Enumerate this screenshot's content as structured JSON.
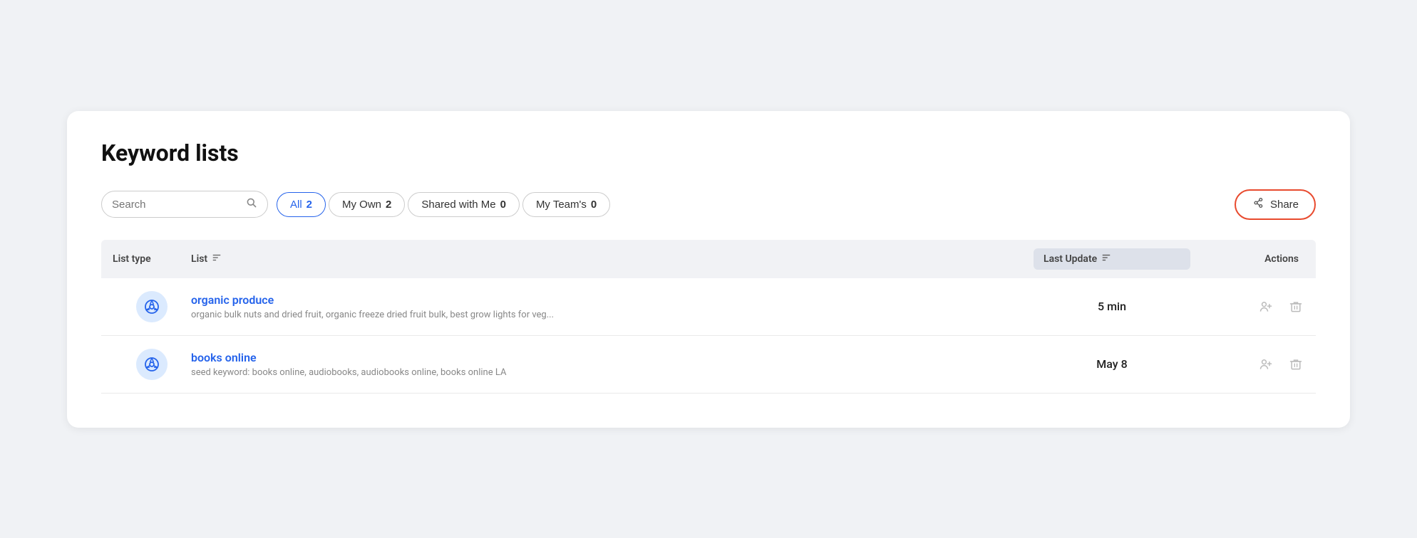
{
  "page": {
    "title": "Keyword lists"
  },
  "search": {
    "placeholder": "Search"
  },
  "filters": [
    {
      "label": "All",
      "count": "2",
      "active": true
    },
    {
      "label": "My Own",
      "count": "2",
      "active": false
    },
    {
      "label": "Shared with Me",
      "count": "0",
      "active": false
    },
    {
      "label": "My Team's",
      "count": "0",
      "active": false
    }
  ],
  "share_button": {
    "label": "Share"
  },
  "table": {
    "headers": {
      "list_type": "List type",
      "list": "List",
      "last_update": "Last Update",
      "actions": "Actions"
    },
    "rows": [
      {
        "name": "organic produce",
        "keywords": "organic bulk nuts and dried fruit, organic freeze dried fruit bulk, best grow lights for veg...",
        "last_update": "5 min"
      },
      {
        "name": "books online",
        "keywords": "seed keyword: books online, audiobooks, audiobooks online, books online LA",
        "last_update": "May 8"
      }
    ]
  }
}
